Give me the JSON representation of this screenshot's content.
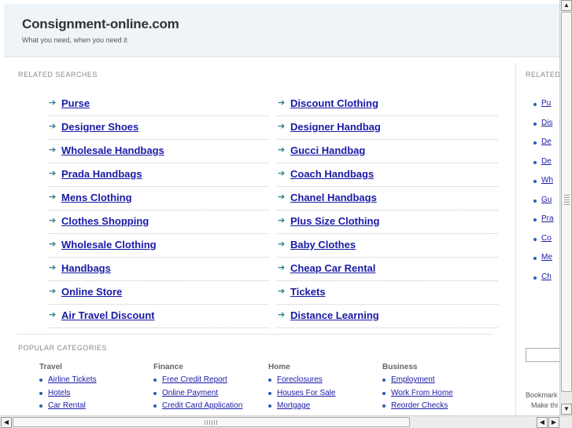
{
  "header": {
    "title": "Consignment-online.com",
    "tagline": "What you need, when you need it"
  },
  "related_searches": {
    "label": "RELATED SEARCHES",
    "left": [
      "Purse",
      "Designer Shoes",
      "Wholesale Handbags",
      "Prada Handbags",
      "Mens Clothing",
      "Clothes Shopping",
      "Wholesale Clothing",
      "Handbags",
      "Online Store",
      "Air Travel Discount"
    ],
    "right": [
      "Discount Clothing",
      "Designer Handbag",
      "Gucci Handbag",
      "Coach Handbags",
      "Chanel Handbags",
      "Plus Size Clothing",
      "Baby Clothes",
      "Cheap Car Rental",
      "Tickets",
      "Distance Learning"
    ]
  },
  "popular_categories": {
    "label": "POPULAR CATEGORIES",
    "columns": [
      {
        "head": "Travel",
        "items": [
          "Airline Tickets",
          "Hotels",
          "Car Rental"
        ]
      },
      {
        "head": "Finance",
        "items": [
          "Free Credit Report",
          "Online Payment",
          "Credit Card Application"
        ]
      },
      {
        "head": "Home",
        "items": [
          "Foreclosures",
          "Houses For Sale",
          "Mortgage"
        ]
      },
      {
        "head": "Business",
        "items": [
          "Employment",
          "Work From Home",
          "Reorder Checks"
        ]
      }
    ]
  },
  "right_panel": {
    "label": "RELATED",
    "items": [
      "Pu",
      "Dis",
      "De",
      "De",
      "Wh",
      "Gu",
      "Pra",
      "Co",
      "Me",
      "Ch"
    ],
    "bookmark_line1": "Bookmark",
    "bookmark_line2": "Make thi"
  },
  "icons": {
    "bullet_arrow": "arrow-right-icon",
    "scroll_up": "▲",
    "scroll_down": "▼",
    "scroll_left": "◀",
    "scroll_right": "▶"
  },
  "colors": {
    "link": "#1a1aa6",
    "header_bg": "#eef4f7",
    "arrow": "#2c7a8a"
  }
}
